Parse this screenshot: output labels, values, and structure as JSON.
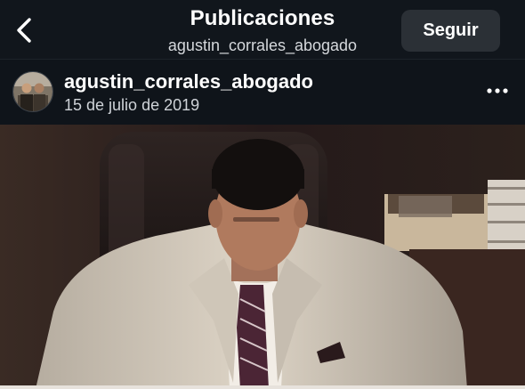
{
  "header": {
    "title": "Publicaciones",
    "subtitle": "agustin_corrales_abogado",
    "follow_label": "Seguir",
    "back_icon": "chevron-left-icon"
  },
  "post": {
    "username": "agustin_corrales_abogado",
    "date": "15 de julio de 2019",
    "more_icon": "more-horizontal-icon"
  },
  "colors": {
    "background": "#0f141a",
    "follow_button": "#2b3036",
    "text_primary": "#ffffff",
    "text_secondary": "#cfd3d8"
  }
}
